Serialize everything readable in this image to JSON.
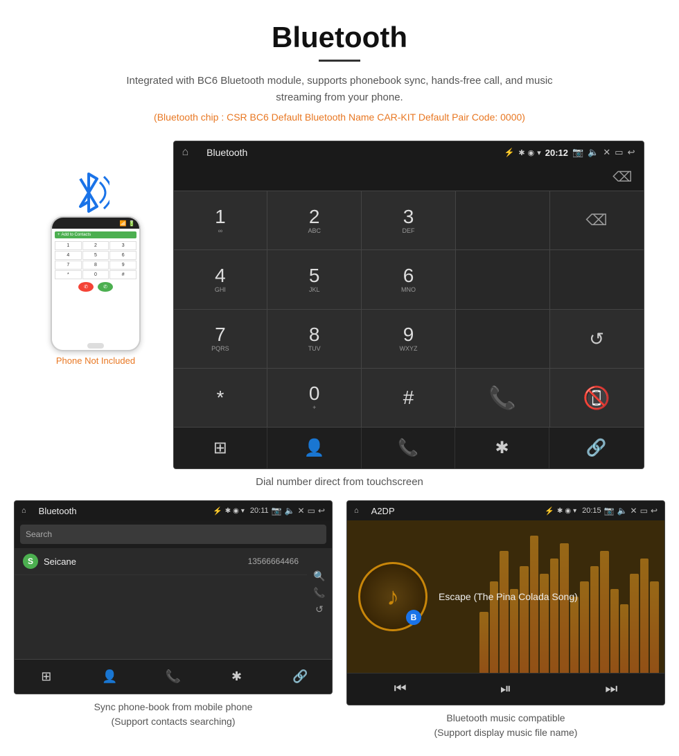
{
  "page": {
    "title": "Bluetooth",
    "subtitle": "Integrated with BC6 Bluetooth module, supports phonebook sync, hands-free call, and music streaming from your phone.",
    "specs": "(Bluetooth chip : CSR BC6    Default Bluetooth Name CAR-KIT    Default Pair Code: 0000)",
    "dial_caption": "Dial number direct from touchscreen",
    "phonebook_caption": "Sync phone-book from mobile phone\n(Support contacts searching)",
    "music_caption": "Bluetooth music compatible\n(Support display music file name)",
    "phone_not_included": "Phone Not Included"
  },
  "car_screen_dialer": {
    "status_bar": {
      "title": "Bluetooth",
      "time": "20:12",
      "usb_icon": "⚡",
      "bt_icon": "✱",
      "location_icon": "◉",
      "signal_icon": "▾"
    },
    "keys": [
      {
        "num": "1",
        "sub": "∞"
      },
      {
        "num": "2",
        "sub": "ABC"
      },
      {
        "num": "3",
        "sub": "DEF"
      },
      {
        "num": "",
        "sub": ""
      },
      {
        "num": "⌫",
        "sub": ""
      },
      {
        "num": "4",
        "sub": "GHI"
      },
      {
        "num": "5",
        "sub": "JKL"
      },
      {
        "num": "6",
        "sub": "MNO"
      },
      {
        "num": "",
        "sub": ""
      },
      {
        "num": "",
        "sub": ""
      },
      {
        "num": "7",
        "sub": "PQRS"
      },
      {
        "num": "8",
        "sub": "TUV"
      },
      {
        "num": "9",
        "sub": "WXYZ"
      },
      {
        "num": "",
        "sub": ""
      },
      {
        "num": "↺",
        "sub": ""
      },
      {
        "num": "*",
        "sub": ""
      },
      {
        "num": "0",
        "sub": "+"
      },
      {
        "num": "#",
        "sub": ""
      },
      {
        "num": "📞",
        "sub": ""
      },
      {
        "num": "📵",
        "sub": ""
      }
    ],
    "bottom_icons": [
      "⊞",
      "👤",
      "📞",
      "✱",
      "🔗"
    ]
  },
  "phonebook_screen": {
    "status_bar": {
      "title": "Bluetooth",
      "time": "20:11",
      "usb_icon": "⚡"
    },
    "search_placeholder": "Search",
    "contact": {
      "letter": "S",
      "name": "Seicane",
      "number": "13566664466"
    },
    "right_sidebar_icons": [
      "🔍",
      "📞",
      "↺"
    ],
    "bottom_icons": [
      "⊞",
      "👤",
      "📞",
      "✱",
      "🔗"
    ]
  },
  "music_screen": {
    "status_bar": {
      "title": "A2DP",
      "time": "20:15",
      "usb_icon": "⚡"
    },
    "song_title": "Escape (The Pina Colada Song)",
    "controls": [
      "⏮",
      "⏯",
      "⏭"
    ],
    "eq_bars": [
      40,
      60,
      80,
      55,
      70,
      90,
      65,
      75,
      85,
      50,
      60,
      70,
      80,
      55,
      45,
      65,
      75,
      60
    ]
  }
}
